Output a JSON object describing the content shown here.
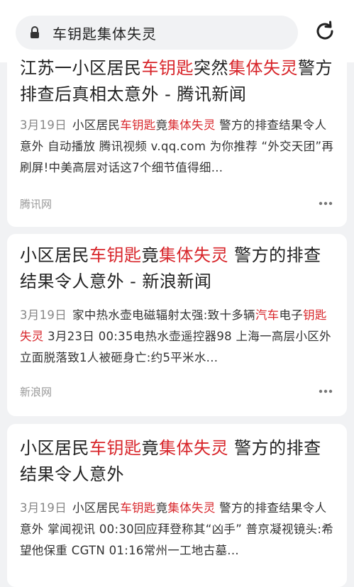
{
  "search": {
    "query": "车钥匙集体失灵"
  },
  "results": [
    {
      "title_parts": [
        {
          "t": "江苏一小区居民",
          "h": false
        },
        {
          "t": "车钥匙",
          "h": true
        },
        {
          "t": "突然",
          "h": false
        },
        {
          "t": "集体失灵",
          "h": true
        },
        {
          "t": "警方排查后真相太意外 - 腾讯新闻",
          "h": false
        }
      ],
      "date": "3月19日",
      "snippet_parts": [
        {
          "t": "小区居民",
          "h": false
        },
        {
          "t": "车钥匙",
          "h": true
        },
        {
          "t": "竟",
          "h": false
        },
        {
          "t": "集体失灵",
          "h": true
        },
        {
          "t": " 警方的排查结果令人意外 自动播放 腾讯视频 v.qq.com 为你推荐 “外交天团”再刷屏!中美高层对话这7个细节值得细...",
          "h": false
        }
      ],
      "source": "腾讯网"
    },
    {
      "title_parts": [
        {
          "t": "小区居民",
          "h": false
        },
        {
          "t": "车钥匙",
          "h": true
        },
        {
          "t": "竟",
          "h": false
        },
        {
          "t": "集体失灵",
          "h": true
        },
        {
          "t": " 警方的排查结果令人意外 - 新浪新闻",
          "h": false
        }
      ],
      "date": "3月19日",
      "snippet_parts": [
        {
          "t": "家中热水壶电磁辐射太强:致十多辆",
          "h": false
        },
        {
          "t": "汽车",
          "h": true
        },
        {
          "t": "电子",
          "h": false
        },
        {
          "t": "钥匙失灵",
          "h": true
        },
        {
          "t": " 3月23日 00:35电热水壶遥控器98 上海一高层小区外立面脱落致1人被砸身亡:约5平米水...",
          "h": false
        }
      ],
      "source": "新浪网"
    },
    {
      "title_parts": [
        {
          "t": "小区居民",
          "h": false
        },
        {
          "t": "车钥匙",
          "h": true
        },
        {
          "t": "竟",
          "h": false
        },
        {
          "t": "集体失灵",
          "h": true
        },
        {
          "t": " 警方的排查结果令人意外",
          "h": false
        }
      ],
      "date": "3月19日",
      "snippet_parts": [
        {
          "t": "小区居民",
          "h": false
        },
        {
          "t": "车钥匙",
          "h": true
        },
        {
          "t": "竟",
          "h": false
        },
        {
          "t": "集体失灵",
          "h": true
        },
        {
          "t": " 警方的排查结果令人意外 掌闻视讯 00:30回应拜登称其“凶手” 普京凝视镜头:希望他保重 CGTN 01:16常州一工地古墓...",
          "h": false
        }
      ],
      "source": ""
    }
  ],
  "colors": {
    "highlight": "#d8262b",
    "background": "#f1f2f4"
  },
  "icons": {
    "lock": "lock-icon",
    "refresh": "refresh-icon",
    "more": "more-dots-icon"
  }
}
